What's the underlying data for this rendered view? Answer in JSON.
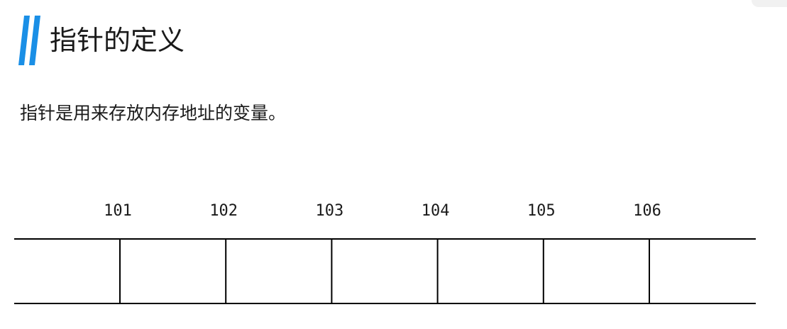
{
  "title": "指针的定义",
  "definition": "指针是用来存放内存地址的变量。",
  "accent_color": "#1a8fe6",
  "icons": {
    "title_marker": "double-slash-icon"
  },
  "memory": {
    "addresses": [
      "101",
      "102",
      "103",
      "104",
      "105",
      "106"
    ],
    "cell_count": 7
  }
}
